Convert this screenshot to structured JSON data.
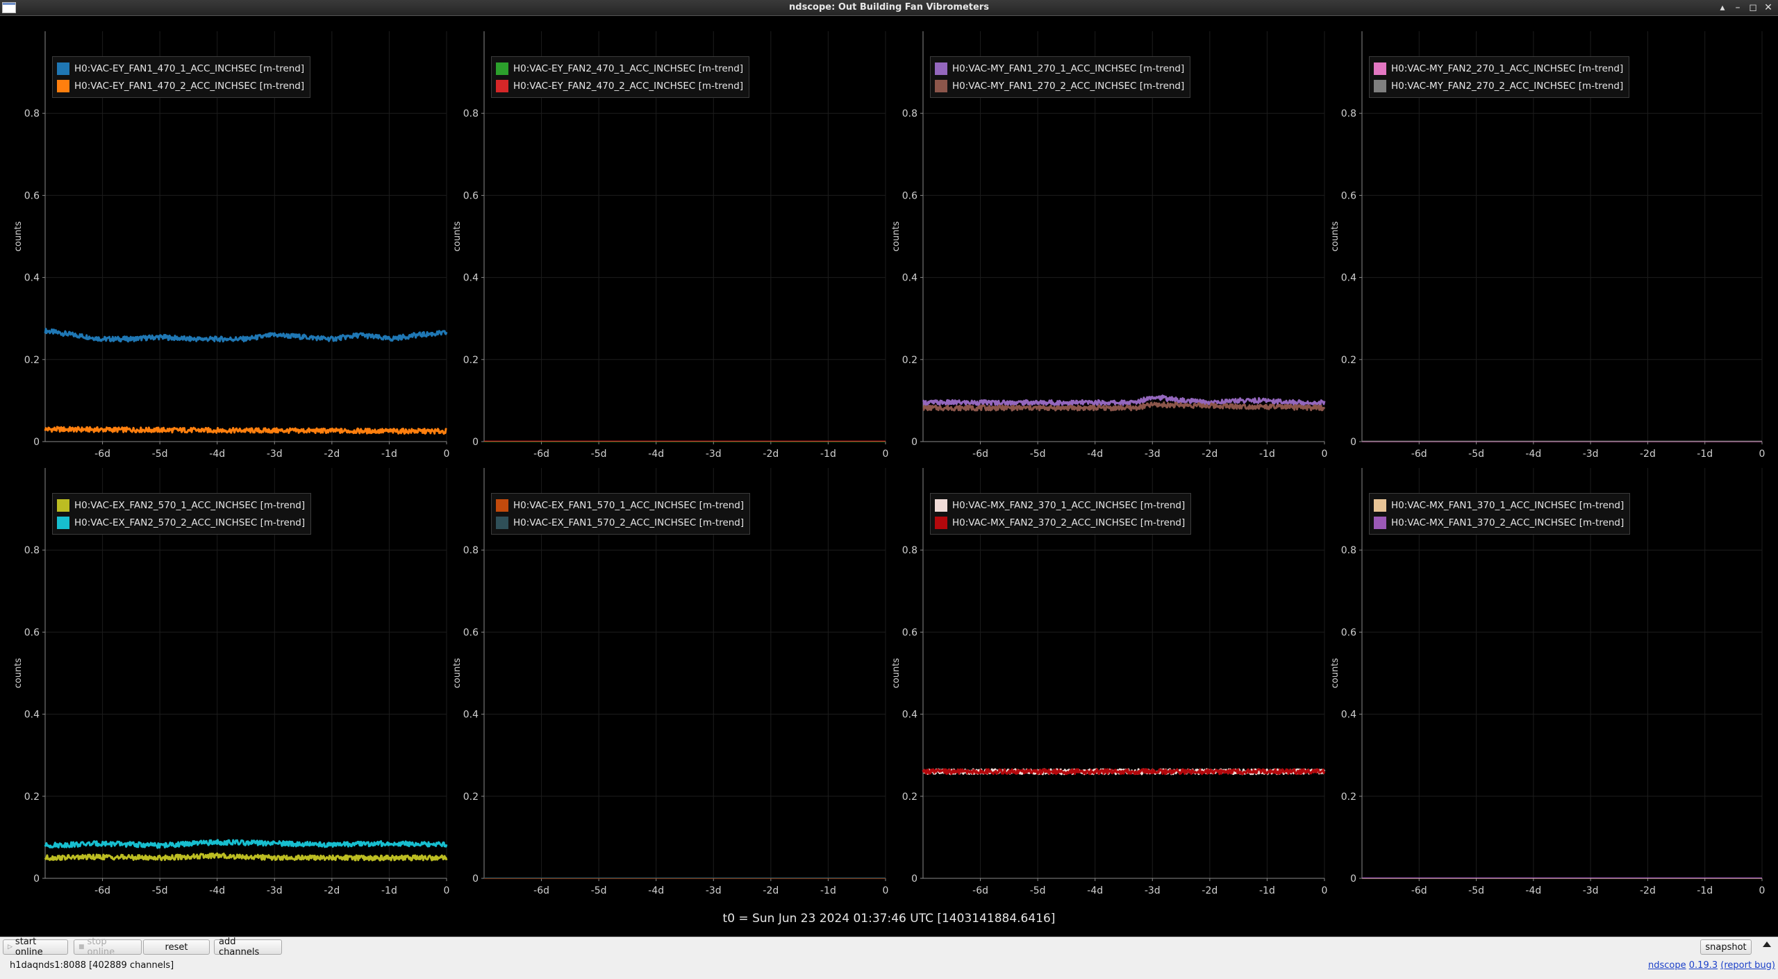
{
  "window": {
    "title": "ndscope: Out Building Fan Vibrometers"
  },
  "t0_label": "t0 = Sun Jun 23 2024 01:37:46 UTC [1403141884.6416]",
  "toolbar": {
    "start_online": "start online",
    "stop_online": "stop online",
    "reset": "reset",
    "add_channels": "add channels",
    "snapshot": "snapshot"
  },
  "status": {
    "server": "h1daqnds1:8088  [402889 channels]"
  },
  "footer": {
    "name": "ndscope",
    "version": "0.19.3",
    "report": "(report bug)"
  },
  "chart_data": [
    {
      "type": "line",
      "ylabel": "counts",
      "ylim": [
        0,
        1
      ],
      "yticks": [
        "0",
        "0.2",
        "0.4",
        "0.6",
        "0.8"
      ],
      "xticks": [
        "-6d",
        "-5d",
        "-4d",
        "-3d",
        "-2d",
        "-1d",
        "0"
      ],
      "series": [
        {
          "name": "H0:VAC-EY_FAN1_470_1_ACC_INCHSEC [m-trend]",
          "color": "#1f77b4",
          "x": [
            -7,
            -6.5,
            -6,
            -5.5,
            -5,
            -4.5,
            -4,
            -3.5,
            -3,
            -2.5,
            -2,
            -1.5,
            -1,
            -0.5,
            0
          ],
          "values": [
            0.27,
            0.26,
            0.25,
            0.25,
            0.255,
            0.25,
            0.25,
            0.25,
            0.26,
            0.255,
            0.25,
            0.26,
            0.25,
            0.26,
            0.265
          ]
        },
        {
          "name": "H0:VAC-EY_FAN1_470_2_ACC_INCHSEC [m-trend]",
          "color": "#ff7f0e",
          "x": [
            -7,
            -3.5,
            0
          ],
          "values": [
            0.03,
            0.027,
            0.025
          ]
        }
      ]
    },
    {
      "type": "line",
      "ylabel": "counts",
      "ylim": [
        0,
        1
      ],
      "yticks": [
        "0",
        "0.2",
        "0.4",
        "0.6",
        "0.8"
      ],
      "xticks": [
        "-6d",
        "-5d",
        "-4d",
        "-3d",
        "-2d",
        "-1d",
        "0"
      ],
      "series": [
        {
          "name": "H0:VAC-EY_FAN2_470_1_ACC_INCHSEC [m-trend]",
          "color": "#2ca02c",
          "x": [
            -7,
            0
          ],
          "values": [
            0,
            0
          ]
        },
        {
          "name": "H0:VAC-EY_FAN2_470_2_ACC_INCHSEC [m-trend]",
          "color": "#d62728",
          "x": [
            -7,
            0
          ],
          "values": [
            0.001,
            0.001
          ]
        }
      ]
    },
    {
      "type": "line",
      "ylabel": "counts",
      "ylim": [
        0,
        1
      ],
      "yticks": [
        "0",
        "0.2",
        "0.4",
        "0.6",
        "0.8"
      ],
      "xticks": [
        "-6d",
        "-5d",
        "-4d",
        "-3d",
        "-2d",
        "-1d",
        "0"
      ],
      "series": [
        {
          "name": "H0:VAC-MY_FAN1_270_1_ACC_INCHSEC [m-trend]",
          "color": "#9467bd",
          "x": [
            -7,
            -6,
            -5,
            -4,
            -3.3,
            -3,
            -2.5,
            -2,
            -1.5,
            -1,
            -0.5,
            0
          ],
          "values": [
            0.095,
            0.095,
            0.095,
            0.095,
            0.095,
            0.11,
            0.1,
            0.095,
            0.1,
            0.1,
            0.095,
            0.095
          ]
        },
        {
          "name": "H0:VAC-MY_FAN1_270_2_ACC_INCHSEC [m-trend]",
          "color": "#8c564b",
          "x": [
            -7,
            -3.3,
            -3,
            0
          ],
          "values": [
            0.082,
            0.082,
            0.09,
            0.082
          ]
        }
      ]
    },
    {
      "type": "line",
      "ylabel": "counts",
      "ylim": [
        0,
        1
      ],
      "yticks": [
        "0",
        "0.2",
        "0.4",
        "0.6",
        "0.8"
      ],
      "xticks": [
        "-6d",
        "-5d",
        "-4d",
        "-3d",
        "-2d",
        "-1d",
        "0"
      ],
      "series": [
        {
          "name": "H0:VAC-MY_FAN2_270_1_ACC_INCHSEC [m-trend]",
          "color": "#e377c2",
          "x": [
            -7,
            0
          ],
          "values": [
            0,
            0
          ]
        },
        {
          "name": "H0:VAC-MY_FAN2_270_2_ACC_INCHSEC [m-trend]",
          "color": "#7f7f7f",
          "x": [
            -7,
            0
          ],
          "values": [
            0.001,
            0.001
          ]
        }
      ]
    },
    {
      "type": "line",
      "ylabel": "counts",
      "ylim": [
        0,
        1
      ],
      "yticks": [
        "0",
        "0.2",
        "0.4",
        "0.6",
        "0.8"
      ],
      "xticks": [
        "-6d",
        "-5d",
        "-4d",
        "-3d",
        "-2d",
        "-1d",
        "0"
      ],
      "series": [
        {
          "name": "H0:VAC-EX_FAN2_570_1_ACC_INCHSEC [m-trend]",
          "color": "#bcbd22",
          "x": [
            -7,
            -6,
            -5,
            -4,
            -3,
            -2,
            -1,
            0
          ],
          "values": [
            0.05,
            0.052,
            0.05,
            0.055,
            0.05,
            0.05,
            0.05,
            0.05
          ]
        },
        {
          "name": "H0:VAC-EX_FAN2_570_2_ACC_INCHSEC [m-trend]",
          "color": "#17becf",
          "x": [
            -7,
            -6,
            -5,
            -4,
            -3,
            -2,
            -1,
            0
          ],
          "values": [
            0.08,
            0.085,
            0.08,
            0.088,
            0.085,
            0.082,
            0.085,
            0.082
          ]
        }
      ]
    },
    {
      "type": "line",
      "ylabel": "counts",
      "ylim": [
        0,
        1
      ],
      "yticks": [
        "0",
        "0.2",
        "0.4",
        "0.6",
        "0.8"
      ],
      "xticks": [
        "-6d",
        "-5d",
        "-4d",
        "-3d",
        "-2d",
        "-1d",
        "0"
      ],
      "series": [
        {
          "name": "H0:VAC-EX_FAN1_570_1_ACC_INCHSEC [m-trend]",
          "color": "#c24a0c",
          "x": [
            -7,
            0
          ],
          "values": [
            0,
            0
          ]
        },
        {
          "name": "H0:VAC-EX_FAN1_570_2_ACC_INCHSEC [m-trend]",
          "color": "#2f4f58",
          "x": [
            -7,
            0
          ],
          "values": [
            0.001,
            0.001
          ]
        }
      ]
    },
    {
      "type": "line",
      "ylabel": "counts",
      "ylim": [
        0,
        1
      ],
      "yticks": [
        "0",
        "0.2",
        "0.4",
        "0.6",
        "0.8"
      ],
      "xticks": [
        "-6d",
        "-5d",
        "-4d",
        "-3d",
        "-2d",
        "-1d",
        "0"
      ],
      "series": [
        {
          "name": "H0:VAC-MX_FAN2_370_1_ACC_INCHSEC [m-trend]",
          "color": "#f0dcd8",
          "x": [
            -7,
            0
          ],
          "values": [
            0.26,
            0.26
          ]
        },
        {
          "name": "H0:VAC-MX_FAN2_370_2_ACC_INCHSEC [m-trend]",
          "color": "#b3080c",
          "x": [
            -7,
            0
          ],
          "values": [
            0.26,
            0.26
          ]
        }
      ]
    },
    {
      "type": "line",
      "ylabel": "counts",
      "ylim": [
        0,
        1
      ],
      "yticks": [
        "0",
        "0.2",
        "0.4",
        "0.6",
        "0.8"
      ],
      "xticks": [
        "-6d",
        "-5d",
        "-4d",
        "-3d",
        "-2d",
        "-1d",
        "0"
      ],
      "series": [
        {
          "name": "H0:VAC-MX_FAN1_370_1_ACC_INCHSEC [m-trend]",
          "color": "#e8c496",
          "x": [
            -7,
            0
          ],
          "values": [
            0,
            0
          ]
        },
        {
          "name": "H0:VAC-MX_FAN1_370_2_ACC_INCHSEC [m-trend]",
          "color": "#9b59b6",
          "x": [
            -7,
            0
          ],
          "values": [
            0.001,
            0.001
          ]
        }
      ]
    }
  ]
}
